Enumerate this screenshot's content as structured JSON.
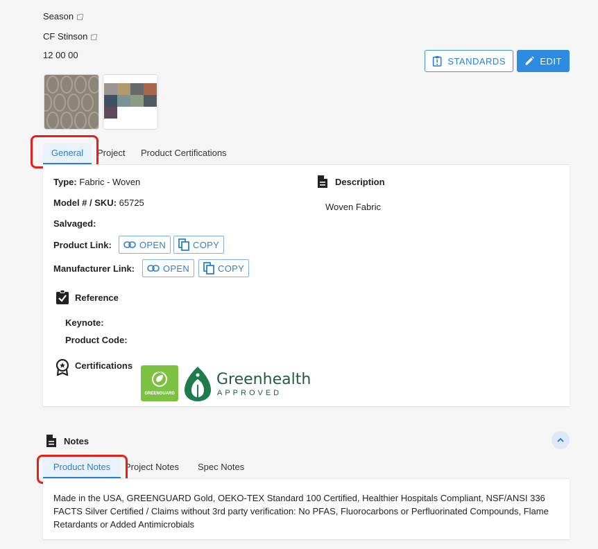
{
  "header": {
    "season": "Season",
    "designer": "CF Stinson",
    "code": "12 00 00"
  },
  "actions": {
    "standards_label": "STANDARDS",
    "edit_label": "EDIT"
  },
  "detail_tabs": [
    {
      "label": "General",
      "active": true
    },
    {
      "label": "Project",
      "active": false
    },
    {
      "label": "Product Certifications",
      "active": false
    }
  ],
  "general": {
    "type_label": "Type:",
    "type_value": "Fabric - Woven",
    "model_label": "Model # / SKU:",
    "model_value": "65725",
    "salvaged_label": "Salvaged:",
    "product_link_label": "Product Link:",
    "manufacturer_link_label": "Manufacturer Link:",
    "open_label": "OPEN",
    "copy_label": "COPY"
  },
  "description": {
    "title": "Description",
    "text": "Woven Fabric"
  },
  "reference": {
    "title": "Reference",
    "keynote_label": "Keynote:",
    "product_code_label": "Product Code:"
  },
  "certifications": {
    "title": "Certifications",
    "greenguard_text": "GREENGUARD",
    "greenguard_mark": "UL",
    "greenhealth_name": "Greenhealth",
    "greenhealth_sub": "APPROVED"
  },
  "notes": {
    "title": "Notes",
    "tabs": [
      {
        "label": "Product Notes",
        "active": true
      },
      {
        "label": "Project Notes",
        "active": false
      },
      {
        "label": "Spec Notes",
        "active": false
      }
    ],
    "text": "Made in the USA, GREENGUARD Gold, OEKO-TEX Standard 100 Certified, Healthier Hospitals Compliant, NSF/ANSI 336 FACTS Silver Certified / Claims without 3rd party verification: No PFAS, Fluorocarbons or Perfluorinated Compounds, Flame Retardants or Added Antimicrobials"
  },
  "colors": {
    "accent": "#2b7fd0",
    "highlight": "#e3201b",
    "greenguard": "#7dc143",
    "greenhealth": "#1f7a4d"
  }
}
